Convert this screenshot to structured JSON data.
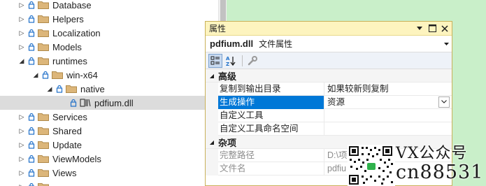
{
  "tree": {
    "items": [
      {
        "label": "Database",
        "expander": "▷",
        "kind": "folder",
        "indent": 0,
        "selected": false
      },
      {
        "label": "Helpers",
        "expander": "▷",
        "kind": "folder",
        "indent": 0,
        "selected": false
      },
      {
        "label": "Localization",
        "expander": "▷",
        "kind": "folder",
        "indent": 0,
        "selected": false
      },
      {
        "label": "Models",
        "expander": "▷",
        "kind": "folder",
        "indent": 0,
        "selected": false
      },
      {
        "label": "runtimes",
        "expander": "◢",
        "kind": "folder",
        "indent": 0,
        "selected": false
      },
      {
        "label": "win-x64",
        "expander": "◢",
        "kind": "folder",
        "indent": 1,
        "selected": false
      },
      {
        "label": "native",
        "expander": "◢",
        "kind": "folder",
        "indent": 2,
        "selected": false
      },
      {
        "label": "pdfium.dll",
        "expander": "",
        "kind": "dll",
        "indent": 3,
        "selected": true
      },
      {
        "label": "Services",
        "expander": "▷",
        "kind": "folder",
        "indent": 0,
        "selected": false
      },
      {
        "label": "Shared",
        "expander": "▷",
        "kind": "folder",
        "indent": 0,
        "selected": false
      },
      {
        "label": "Update",
        "expander": "▷",
        "kind": "folder",
        "indent": 0,
        "selected": false
      },
      {
        "label": "ViewModels",
        "expander": "▷",
        "kind": "folder",
        "indent": 0,
        "selected": false
      },
      {
        "label": "Views",
        "expander": "▷",
        "kind": "folder",
        "indent": 0,
        "selected": false
      },
      {
        "label": "",
        "expander": "▷",
        "kind": "folder",
        "indent": 0,
        "selected": false
      }
    ]
  },
  "properties": {
    "title": "属性",
    "object_name": "pdfium.dll",
    "object_type": "文件属性",
    "categories": [
      {
        "label": "高级",
        "rows": [
          {
            "name": "复制到输出目录",
            "value": "如果较新则复制",
            "selected": false,
            "readonly": false,
            "dropdown": false
          },
          {
            "name": "生成操作",
            "value": "资源",
            "selected": true,
            "readonly": false,
            "dropdown": true
          },
          {
            "name": "自定义工具",
            "value": "",
            "selected": false,
            "readonly": false,
            "dropdown": false
          },
          {
            "name": "自定义工具命名空间",
            "value": "",
            "selected": false,
            "readonly": false,
            "dropdown": false
          }
        ]
      },
      {
        "label": "杂项",
        "rows": [
          {
            "name": "完整路径",
            "value": "D:\\项",
            "selected": false,
            "readonly": true,
            "dropdown": false
          },
          {
            "name": "文件名",
            "value": "pdfiu",
            "selected": false,
            "readonly": true,
            "dropdown": false
          }
        ]
      }
    ]
  },
  "watermark": {
    "line1": "VX公众号",
    "line2": "cn88531"
  },
  "colors": {
    "accent": "#0078d7",
    "title_bar": "#fdf4bf",
    "window_border": "#c9b15a",
    "background": "#c9efc9",
    "folder": "#dcb67a",
    "lock": "#1e6fc8"
  }
}
